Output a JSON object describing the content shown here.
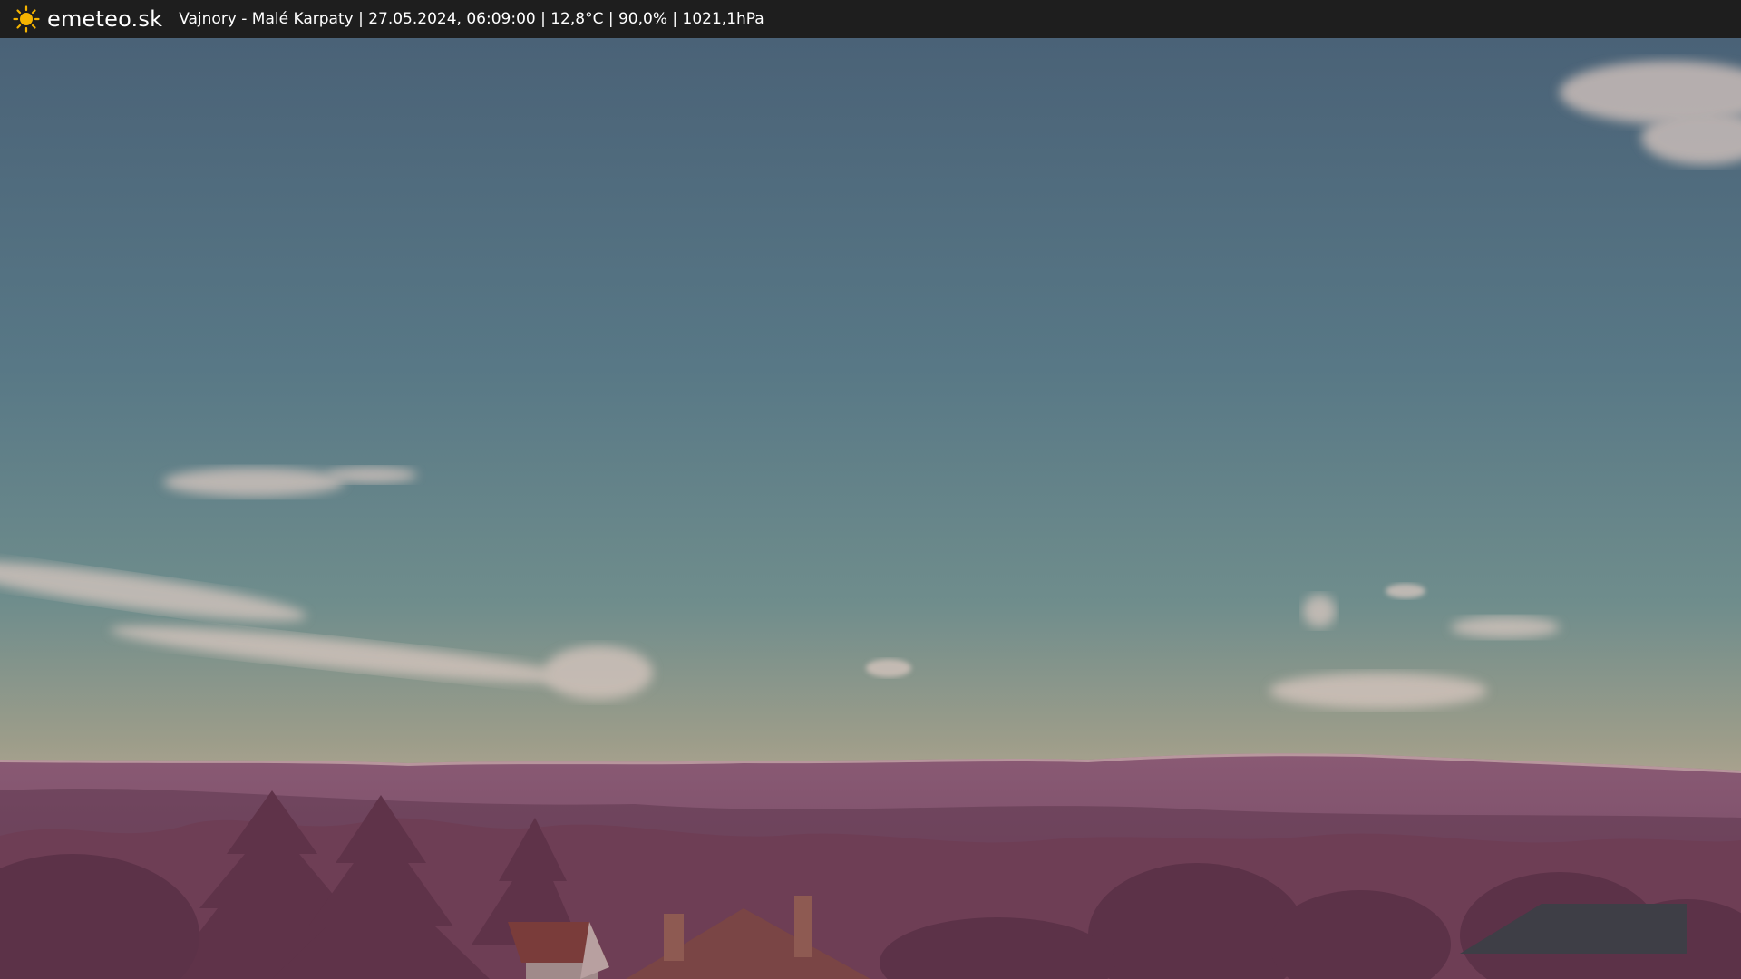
{
  "header": {
    "brand": "emeteo.sk",
    "caption": "Vajnory - Malé Karpaty | 27.05.2024, 06:09:00 | 12,8°C | 90,0% | 1021,1hPa",
    "icon": "sun-icon"
  },
  "colors": {
    "bar_bg": "#1e1e1e",
    "sky_top": "#4e6a7f",
    "sky_mid": "#6a8a8f",
    "sky_horizon": "#c8b19a",
    "hills": "#7a4a65",
    "trees": "#6a3b52",
    "field": "#a07f68"
  }
}
